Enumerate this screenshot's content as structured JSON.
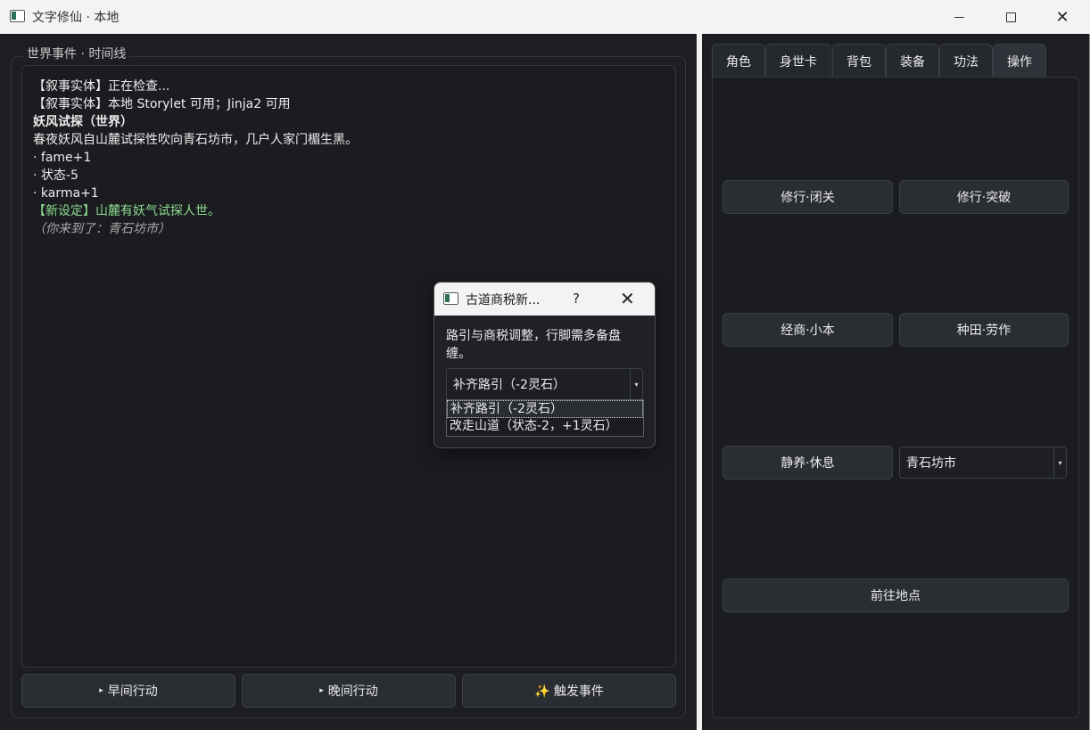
{
  "window": {
    "title": "文字修仙 · 本地",
    "minimize": "",
    "close": "✕"
  },
  "left": {
    "group_title": "世界事件 · 时间线",
    "log": [
      {
        "text": "【叙事实体】正在检查...",
        "style": "normal"
      },
      {
        "text": "【叙事实体】本地 Storylet 可用；Jinja2 可用",
        "style": "normal"
      },
      {
        "text": "妖风试探（世界）",
        "style": "bold"
      },
      {
        "text": "春夜妖风自山麓试探性吹向青石坊市，几户人家门楣生黑。",
        "style": "normal"
      },
      {
        "text": "· fame+1",
        "style": "normal"
      },
      {
        "text": "· 状态-5",
        "style": "normal"
      },
      {
        "text": "· karma+1",
        "style": "normal"
      },
      {
        "text": "【新设定】山麓有妖气试探人世。",
        "style": "green"
      },
      {
        "text": "（你来到了：青石坊市）",
        "style": "gray"
      }
    ],
    "buttons": {
      "morning": "早间行动",
      "evening": "晚间行动",
      "trigger": "✨ 触发事件",
      "play_icon": "▸"
    }
  },
  "right": {
    "tabs": [
      "角色",
      "身世卡",
      "背包",
      "装备",
      "功法",
      "操作"
    ],
    "active_tab": "操作",
    "actions": {
      "seclusion": "修行·闭关",
      "breakthrough": "修行·突破",
      "trade": "经商·小本",
      "farming": "种田·劳作",
      "rest": "静养·休息",
      "travel": "前往地点"
    },
    "location_select": {
      "value": "青石坊市",
      "arrow": "▾"
    }
  },
  "dialog": {
    "title": "古道商税新...",
    "help": "?",
    "close": "✕",
    "message": "路引与商税调整，行脚需多备盘缠。",
    "select_value": "补齐路引（-2灵石）",
    "options": [
      "补齐路引（-2灵石）",
      "改走山道（状态-2，+1灵石）"
    ]
  }
}
